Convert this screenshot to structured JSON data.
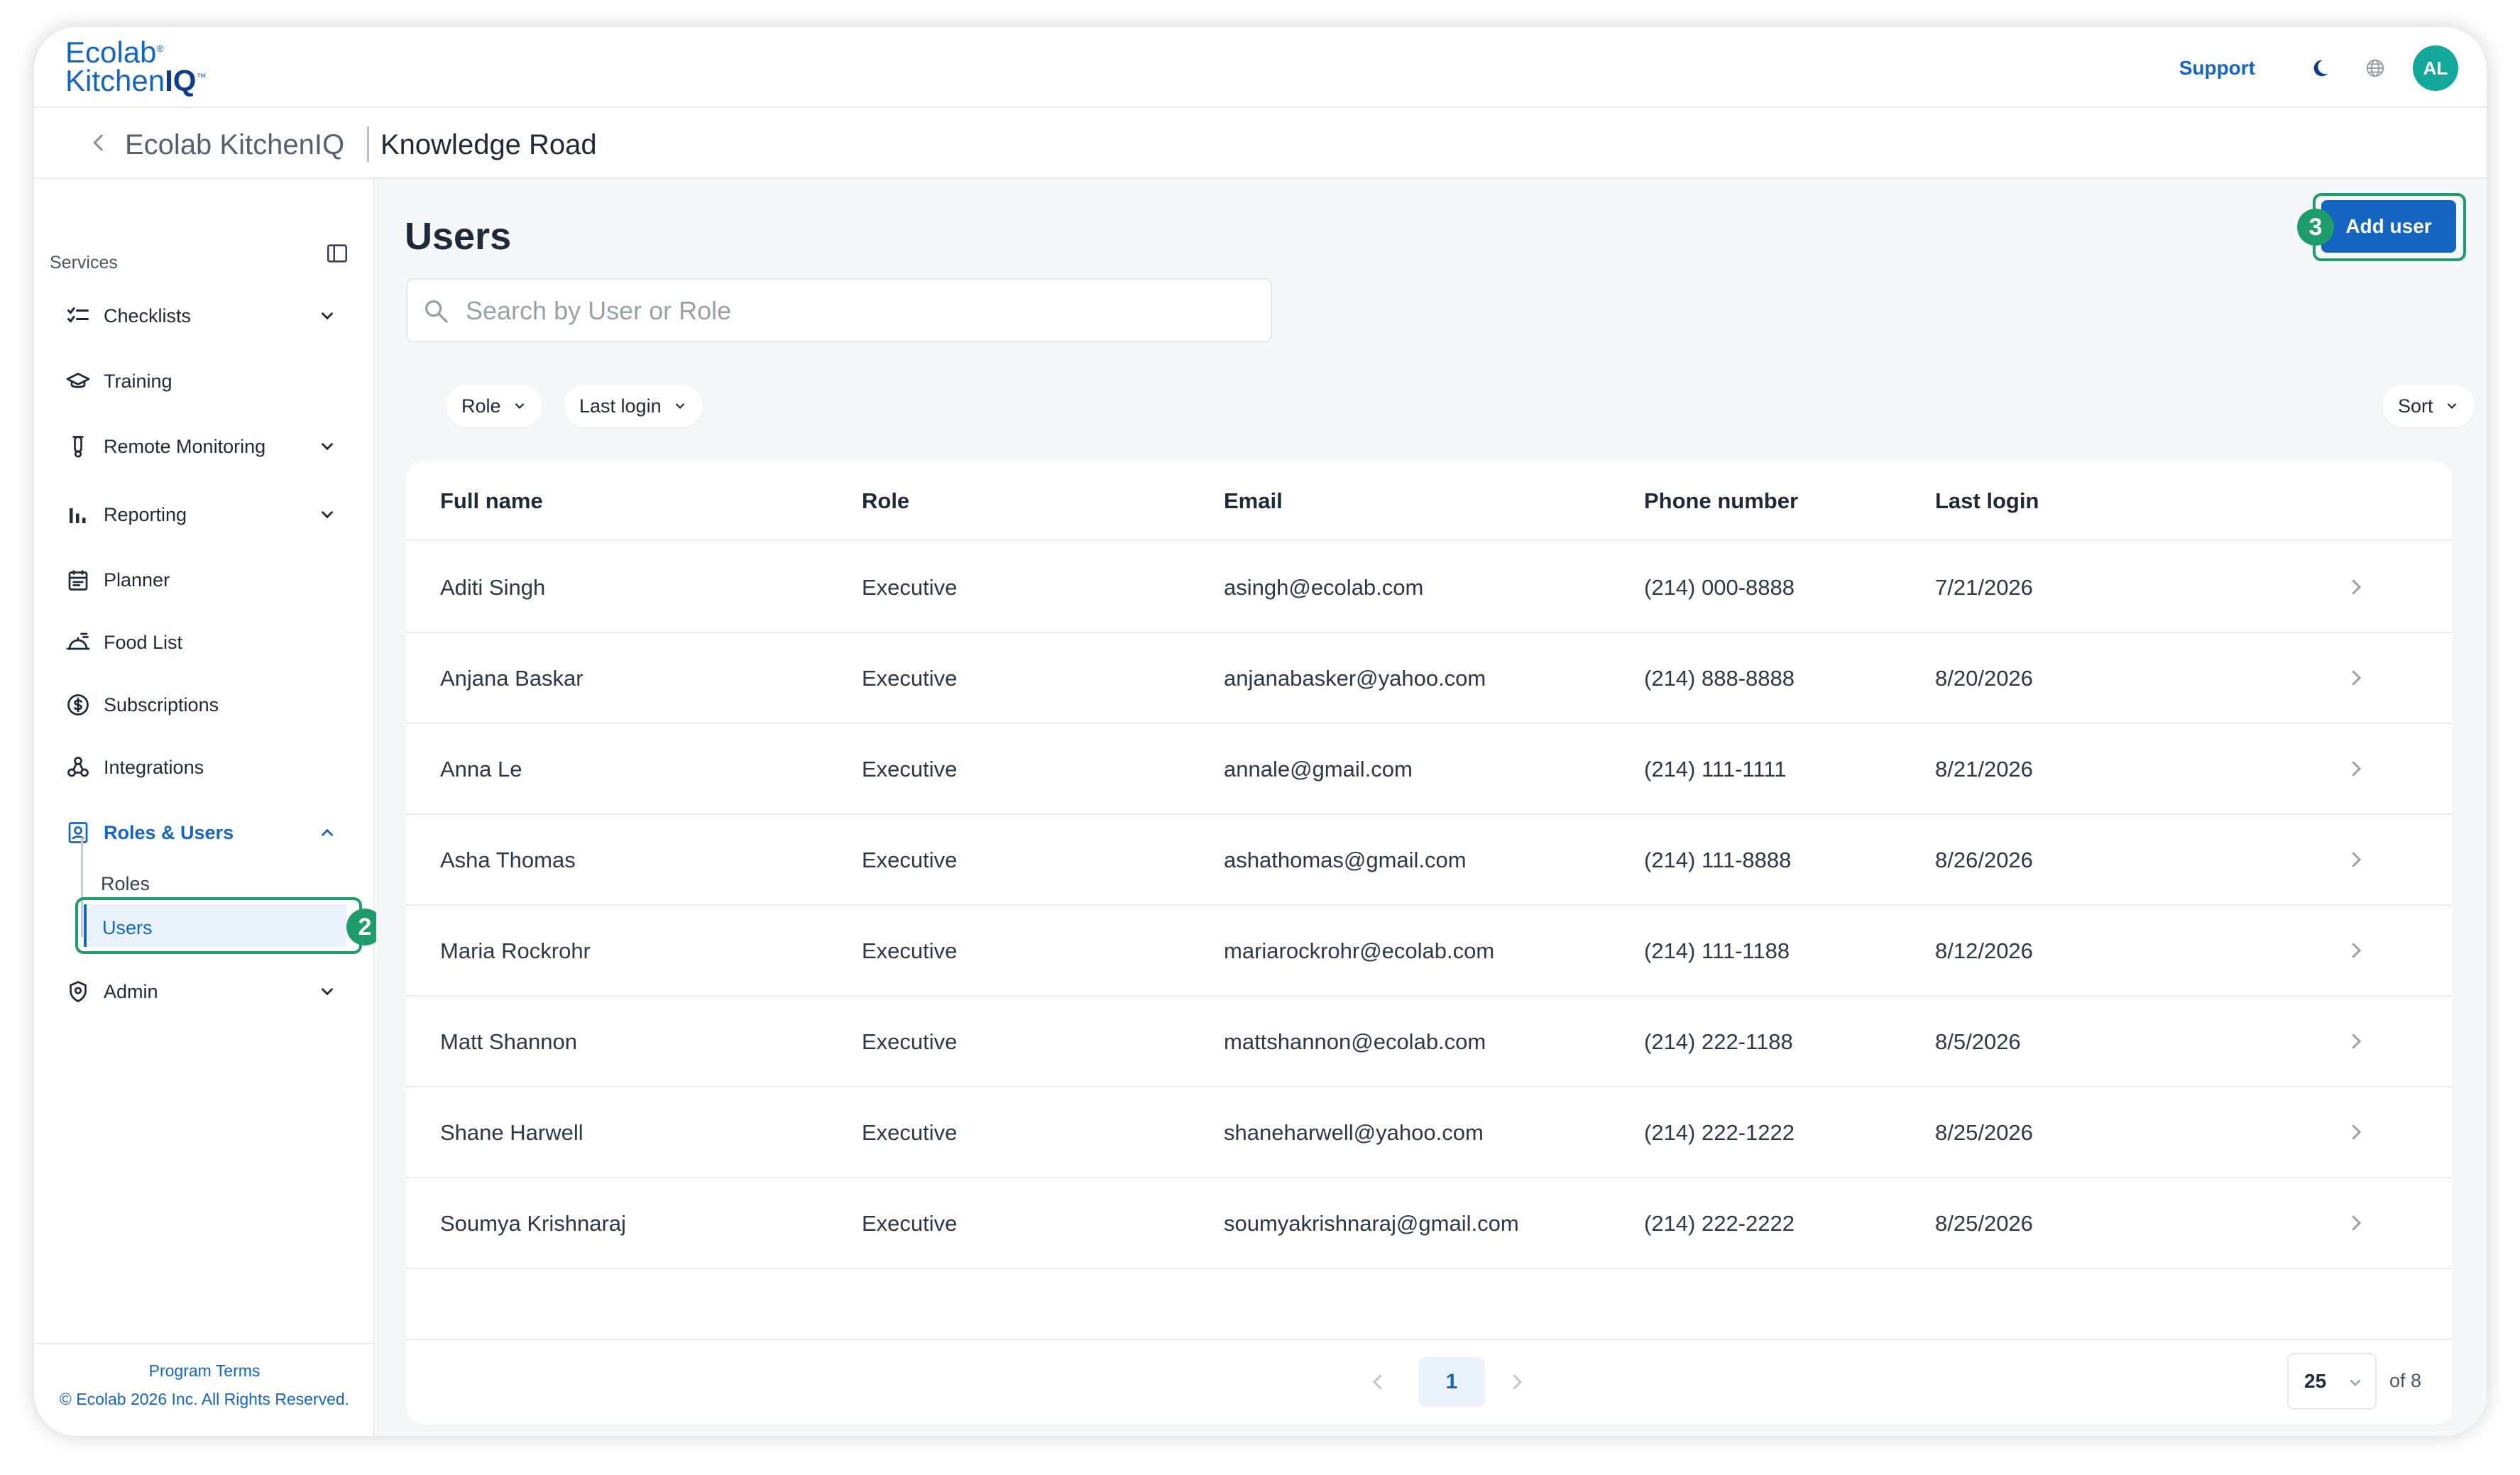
{
  "header": {
    "logo_line1": "Ecolab",
    "logo_reg": "®",
    "logo_line2_a": "Kitchen",
    "logo_line2_b": "IQ",
    "logo_tm": "™",
    "support": "Support",
    "avatar": "AL"
  },
  "breadcrumb": {
    "app": "Ecolab KitchenIQ",
    "site": "Knowledge Road"
  },
  "sidebar": {
    "section_label": "Services",
    "items": [
      {
        "label": "Checklists",
        "icon": "checklist-icon"
      },
      {
        "label": "Training",
        "icon": "graduation-cap-icon"
      },
      {
        "label": "Remote Monitoring",
        "icon": "thermometer-icon"
      },
      {
        "label": "Reporting",
        "icon": "bar-chart-icon"
      },
      {
        "label": "Planner",
        "icon": "calendar-icon"
      },
      {
        "label": "Food List",
        "icon": "food-tray-icon"
      },
      {
        "label": "Subscriptions",
        "icon": "dollar-circle-icon"
      },
      {
        "label": "Integrations",
        "icon": "integrations-icon"
      },
      {
        "label": "Roles & Users",
        "icon": "id-badge-icon"
      },
      {
        "label": "Admin",
        "icon": "shield-icon"
      }
    ],
    "subitems": [
      "Roles",
      "Users"
    ],
    "footer_terms": "Program Terms",
    "footer_copy": "© Ecolab 2026 Inc. All Rights Reserved."
  },
  "annotations": {
    "users_step": "2",
    "add_user_step": "3"
  },
  "main": {
    "title": "Users",
    "add_button": "Add user",
    "search_placeholder": "Search by User or Role",
    "filters": [
      "Role",
      "Last login"
    ],
    "sort": "Sort",
    "columns": [
      "Full name",
      "Role",
      "Email",
      "Phone number",
      "Last login"
    ],
    "rows": [
      [
        "Aditi Singh",
        "Executive",
        "asingh@ecolab.com",
        "(214) 000-8888",
        "7/21/2026"
      ],
      [
        "Anjana Baskar",
        "Executive",
        "anjanabasker@yahoo.com",
        "(214) 888-8888",
        "8/20/2026"
      ],
      [
        "Anna Le",
        "Executive",
        "annale@gmail.com",
        "(214) 111-1111",
        "8/21/2026"
      ],
      [
        "Asha Thomas",
        "Executive",
        "ashathomas@gmail.com",
        "(214) 111-8888",
        "8/26/2026"
      ],
      [
        "Maria Rockrohr",
        "Executive",
        "mariarockrohr@ecolab.com",
        "(214) 111-1188",
        "8/12/2026"
      ],
      [
        "Matt Shannon",
        "Executive",
        "mattshannon@ecolab.com",
        "(214) 222-1188",
        "8/5/2026"
      ],
      [
        "Shane Harwell",
        "Executive",
        "shaneharwell@yahoo.com",
        "(214) 222-1222",
        "8/25/2026"
      ],
      [
        "Soumya Krishnaraj",
        "Executive",
        "soumyakrishnaraj@gmail.com",
        "(214) 222-2222",
        "8/25/2026"
      ]
    ],
    "pagination": {
      "current": "1",
      "per_page": "25",
      "of_total": "of 8"
    }
  },
  "colors": {
    "accent": "#1565c0",
    "highlight": "#1e9c6b",
    "avatar": "#14a89a"
  }
}
